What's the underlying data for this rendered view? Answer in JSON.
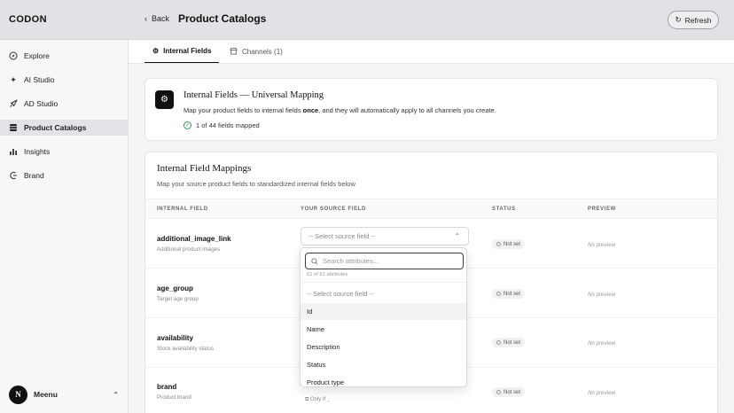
{
  "app": {
    "logo": "CODON"
  },
  "header": {
    "back_label": "Back",
    "title": "Product Catalogs",
    "refresh_label": "Refresh"
  },
  "sidebar": {
    "items": [
      {
        "label": "Explore",
        "icon": "compass-icon",
        "active": false
      },
      {
        "label": "AI Studio",
        "icon": "sparkle-icon",
        "active": false
      },
      {
        "label": "AD Studio",
        "icon": "rocket-icon",
        "active": false
      },
      {
        "label": "Product Catalogs",
        "icon": "stack-icon",
        "active": true
      },
      {
        "label": "Insights",
        "icon": "bar-chart-icon",
        "active": false
      },
      {
        "label": "Brand",
        "icon": "brand-icon",
        "active": false
      }
    ],
    "user": {
      "initial": "N",
      "name": "Meenu"
    }
  },
  "tabs": [
    {
      "label": "Internal Fields",
      "icon": "gear-icon",
      "active": true
    },
    {
      "label": "Channels (1)",
      "icon": "store-icon",
      "active": false
    }
  ],
  "info_card": {
    "title": "Internal Fields — Universal Mapping",
    "desc_before": "Map your product fields to internal fields ",
    "desc_bold": "once",
    "desc_after": ", and they will automatically apply to all channels you create.",
    "status": "1 of 44 fields mapped"
  },
  "mappings": {
    "title": "Internal Field Mappings",
    "subtitle": "Map your source product fields to standardized internal fields below",
    "columns": [
      "INTERNAL FIELD",
      "YOUR SOURCE FIELD",
      "STATUS",
      "PREVIEW"
    ],
    "rows": [
      {
        "name": "additional_image_link",
        "desc": "Additional product images",
        "select": "-- Select source field --",
        "status": "Not set",
        "preview": "No preview"
      },
      {
        "name": "age_group",
        "desc": "Target age group",
        "status": "Not set",
        "preview": "No preview"
      },
      {
        "name": "availability",
        "desc": "Stock availability status",
        "status": "Not set",
        "preview": "No preview"
      },
      {
        "name": "brand",
        "desc": "Product brand",
        "status": "Not set",
        "preview": "No preview"
      }
    ],
    "only_if": "Only If"
  },
  "dropdown": {
    "search_placeholder": "Search attributes...",
    "count": "61 of 61 attributes",
    "options": [
      "-- Select source field --",
      "Id",
      "Name",
      "Description",
      "Status",
      "Product type"
    ]
  }
}
